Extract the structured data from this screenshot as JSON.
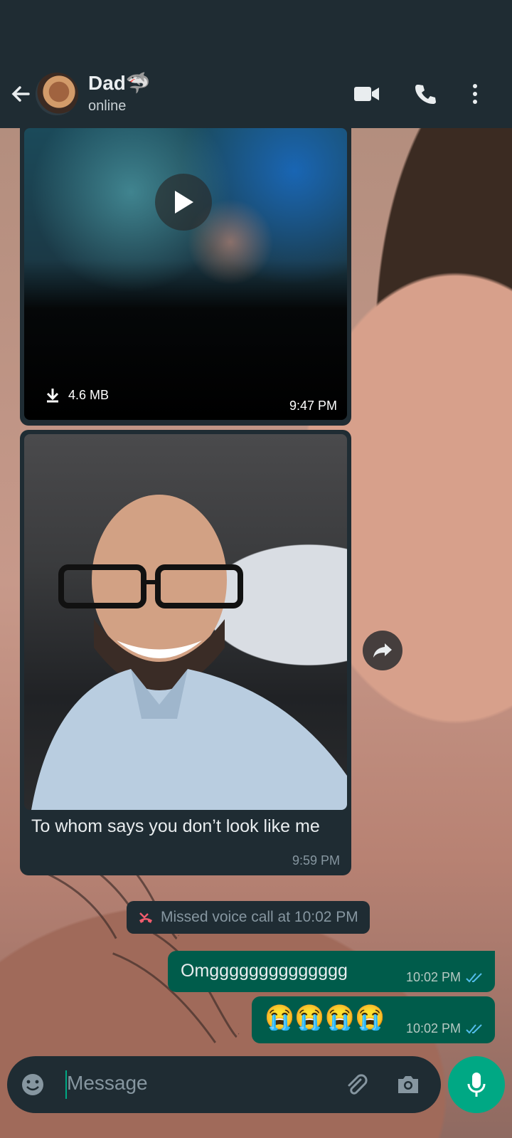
{
  "header": {
    "contact_name": "Dad🦈",
    "status": "online",
    "icons": [
      "back-arrow-icon",
      "video-call-icon",
      "voice-call-icon",
      "more-options-icon"
    ]
  },
  "messages": {
    "video": {
      "size": "4.6 MB",
      "time": "9:47 PM"
    },
    "photo": {
      "caption": "To whom says you don’t look like me",
      "time": "9:59 PM"
    },
    "missed_call": {
      "text": "Missed voice call at 10:02 PM"
    },
    "out1": {
      "text": "Omgggggggggggggg",
      "time": "10:02 PM"
    },
    "out2": {
      "text": "😭😭😭😭",
      "time": "10:02 PM"
    }
  },
  "composer": {
    "placeholder": "Message"
  },
  "colors": {
    "accent": "#00a884",
    "outgoing": "#005c4b",
    "panel": "#1f2c33",
    "read_ticks": "#53bdeb"
  }
}
